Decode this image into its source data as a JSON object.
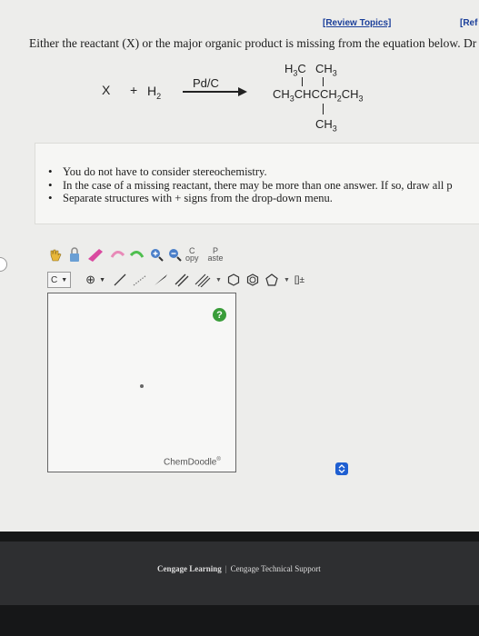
{
  "header": {
    "review_topics": "[Review Topics]",
    "references": "[Ref"
  },
  "question": {
    "text": "Either the reactant (X) or the major organic product is missing from the equation below. Dr"
  },
  "equation": {
    "reactant_x": "X",
    "plus": "+",
    "h2_prefix": "H",
    "h2_sub": "2",
    "catalyst": "Pd/C",
    "product": {
      "top_left": "H3C",
      "top_right": "CH3",
      "main_chain": "CH3CHCCH2CH3",
      "bottom": "CH3"
    }
  },
  "notes": {
    "items": [
      "You do not have to consider stereochemistry.",
      "In the case of a missing reactant, there may be more than one answer. If so, draw all p",
      "Separate structures with + signs from the drop-down menu."
    ]
  },
  "chemdoodle": {
    "copy_label_top": "C",
    "copy_label_bottom": "opy",
    "paste_label_top": "P",
    "paste_label_bottom": "aste",
    "element_select": "C",
    "charge_button": "⊕",
    "bracket_button": "[]±",
    "help": "?",
    "brand": "ChemDoodle"
  },
  "footer": {
    "left": "Cengage Learning",
    "separator": "|",
    "right": "Cengage Technical Support"
  },
  "colors": {
    "link": "#1b3f9a",
    "help": "#3a9d3a",
    "scroll_button": "#1f5fd1"
  }
}
